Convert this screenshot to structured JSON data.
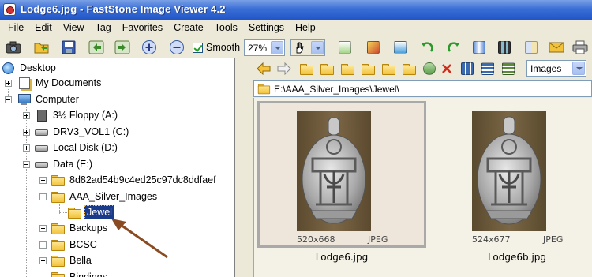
{
  "window": {
    "title": "Lodge6.jpg - FastStone Image Viewer 4.2"
  },
  "menu": [
    "File",
    "Edit",
    "View",
    "Tag",
    "Favorites",
    "Create",
    "Tools",
    "Settings",
    "Help"
  ],
  "toolbar": {
    "smooth_label": "Smooth",
    "smooth_checked": true,
    "zoom_value": "27%",
    "view_filter": "Images",
    "icons": [
      "camera-icon",
      "open-folder-icon",
      "save-icon",
      "previous-icon",
      "next-icon",
      "zoom-in-icon",
      "zoom-out-icon"
    ]
  },
  "tree": {
    "items": [
      {
        "label": "Desktop"
      },
      {
        "label": "My Documents"
      },
      {
        "label": "Computer"
      },
      {
        "label": "3½ Floppy (A:)"
      },
      {
        "label": "DRV3_VOL1 (C:)"
      },
      {
        "label": "Local Disk (D:)"
      },
      {
        "label": "Data (E:)"
      },
      {
        "label": "8d82ad54b9c4ed25c97dc8ddfaef"
      },
      {
        "label": "AAA_Silver_Images"
      },
      {
        "label": "Jewel"
      },
      {
        "label": "Backups"
      },
      {
        "label": "BCSC"
      },
      {
        "label": "Bella"
      },
      {
        "label": "Bindings"
      }
    ]
  },
  "browser": {
    "path": "E:\\AAA_Silver_Images\\Jewel\\",
    "thumbnails": [
      {
        "dimensions": "520x668",
        "format": "JPEG",
        "name": "Lodge6.jpg",
        "selected": true
      },
      {
        "dimensions": "524x677",
        "format": "JPEG",
        "name": "Lodge6b.jpg",
        "selected": false
      }
    ]
  },
  "colors": {
    "titlebar": "#2155c8",
    "selection": "#1a3a8a",
    "annotation_arrow": "#8a4a22"
  }
}
